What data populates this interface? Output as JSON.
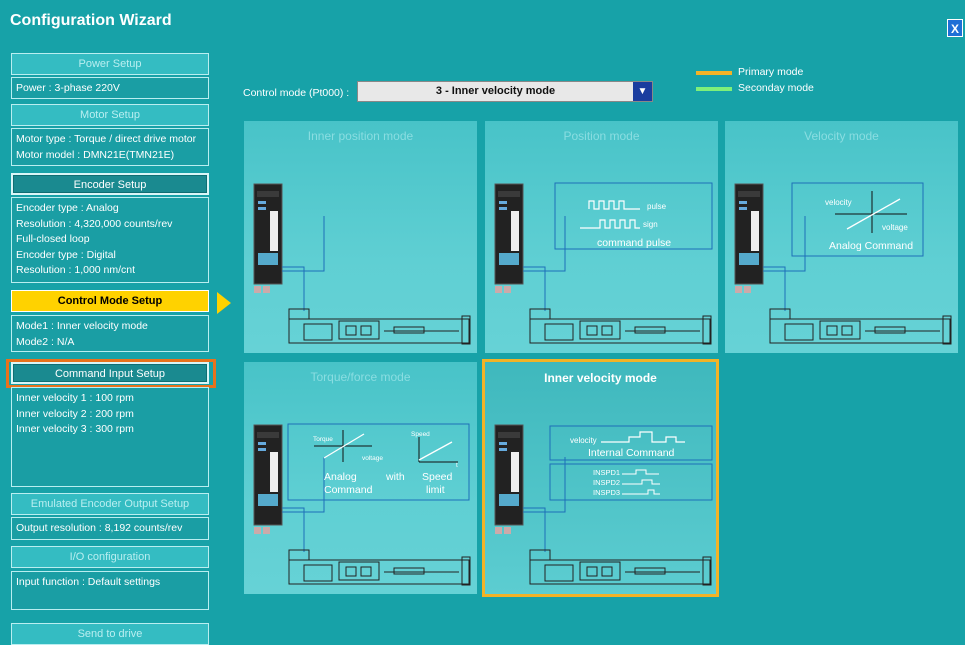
{
  "window": {
    "title": "Configuration Wizard",
    "close_label": "X"
  },
  "sidebar": {
    "power": {
      "label": "Power Setup",
      "lines": [
        "Power :  3-phase 220V"
      ]
    },
    "motor": {
      "label": "Motor Setup",
      "lines": [
        "Motor type : Torque / direct drive motor",
        "Motor model  : DMN21E(TMN21E)"
      ]
    },
    "encoder": {
      "label": "Encoder Setup",
      "lines": [
        "Encoder type : Analog",
        "Resolution : 4,320,000 counts/rev",
        "Full-closed loop",
        "Encoder type : Digital",
        "Resolution : 1,000 nm/cnt"
      ]
    },
    "control": {
      "label": "Control Mode Setup",
      "lines": [
        "Mode1 : Inner velocity mode",
        "Mode2 : N/A"
      ]
    },
    "command": {
      "label": "Command Input Setup",
      "lines": [
        "Inner velocity 1 : 100 rpm",
        "Inner velocity 2 : 200 rpm",
        "Inner velocity 3 : 300 rpm"
      ]
    },
    "emulated": {
      "label": "Emulated Encoder Output Setup",
      "lines": [
        "Output resolution : 8,192 counts/rev"
      ]
    },
    "io": {
      "label": "I/O configuration",
      "lines": [
        "Input function : Default settings"
      ]
    },
    "send": {
      "label": "Send to drive"
    }
  },
  "control_mode": {
    "label": "Control mode (Pt000) :",
    "value": "3 - Inner velocity mode"
  },
  "legend": [
    {
      "label": "Primary mode",
      "color": "#f2b327"
    },
    {
      "label": "Seconday mode",
      "color": "#7ef07a"
    }
  ],
  "panels": {
    "inner_position": {
      "title": "Inner position mode"
    },
    "position": {
      "title": "Position mode",
      "pulse": "pulse",
      "sign": "sign",
      "caption": "command pulse"
    },
    "velocity": {
      "title": "Velocity mode",
      "y": "velocity",
      "x": "voltage",
      "caption": "Analog Command"
    },
    "torque": {
      "title": "Torque/force mode",
      "y1": "Torque",
      "x1": "voltage",
      "y2": "Speed",
      "x2": "t",
      "cap1a": "Analog",
      "cap1b": "Command",
      "with": "with",
      "cap2a": "Speed",
      "cap2b": "limit"
    },
    "inner_velocity": {
      "title": "Inner velocity mode",
      "y": "velocity",
      "caption": "Internal Command",
      "s1": "INSPD1",
      "s2": "INSPD2",
      "s3": "INSPD3"
    }
  },
  "colors": {
    "background": "#17a2a8",
    "current_step": "#ffd200",
    "highlight": "#e8721c",
    "primary": "#f2b327",
    "secondary": "#7ef07a"
  }
}
